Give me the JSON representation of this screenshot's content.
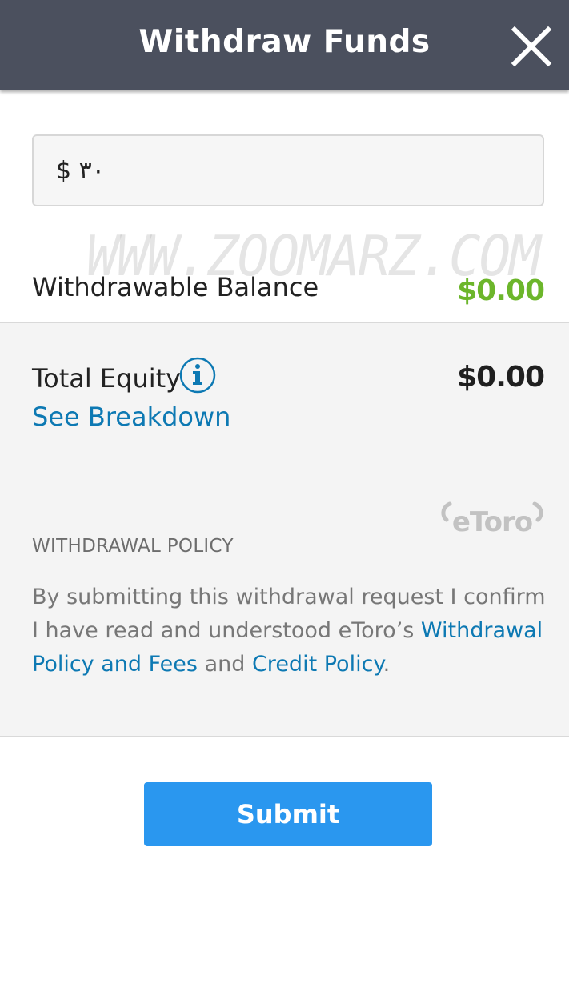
{
  "header": {
    "title": "Withdraw Funds",
    "close_icon": "close-icon",
    "background_color": "#4b505e"
  },
  "amount": {
    "value": "$ ٣٠"
  },
  "watermark": {
    "text": "WWW.ZOOMARZ.COM"
  },
  "withdrawable_balance": {
    "label": "Withdrawable Balance",
    "value": "$0.00",
    "value_color": "#6cb62b"
  },
  "total_equity": {
    "label": "Total Equity",
    "info_icon": "info-icon",
    "value": "$0.00",
    "breakdown_link": "See Breakdown"
  },
  "policy": {
    "logo_text": "eToro",
    "title": "WITHDRAWAL POLICY",
    "text_part1": "By submitting this withdrawal request I confirm I have read and understood eToro’s ",
    "link1": "Withdrawal Policy and Fees",
    "text_part2": " and ",
    "link2": "Credit Policy",
    "text_part3": "."
  },
  "submit": {
    "label": "Submit",
    "color": "#2a97ef"
  }
}
